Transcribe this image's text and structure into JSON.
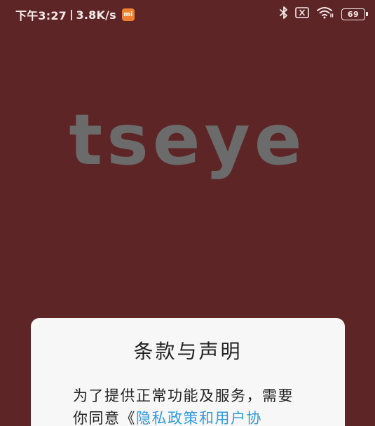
{
  "status_bar": {
    "time": "下午3:27",
    "net_speed": "3.8K/s",
    "mi_badge": "mi",
    "icons": [
      "bluetooth-icon",
      "sim-off-icon",
      "wifi-icon",
      "battery-icon"
    ],
    "battery_level": "69"
  },
  "app": {
    "logo_text": "tseye"
  },
  "dialog": {
    "title": "条款与声明",
    "body_prefix": "为了提供正常功能及服务，需要你同意《",
    "link_text": "隐私政策和用户协"
  },
  "colors": {
    "background": "#5e2527",
    "logo": "#6b6b6b",
    "dialog_bg": "#f8f7f7",
    "link": "#2f9ad8"
  }
}
